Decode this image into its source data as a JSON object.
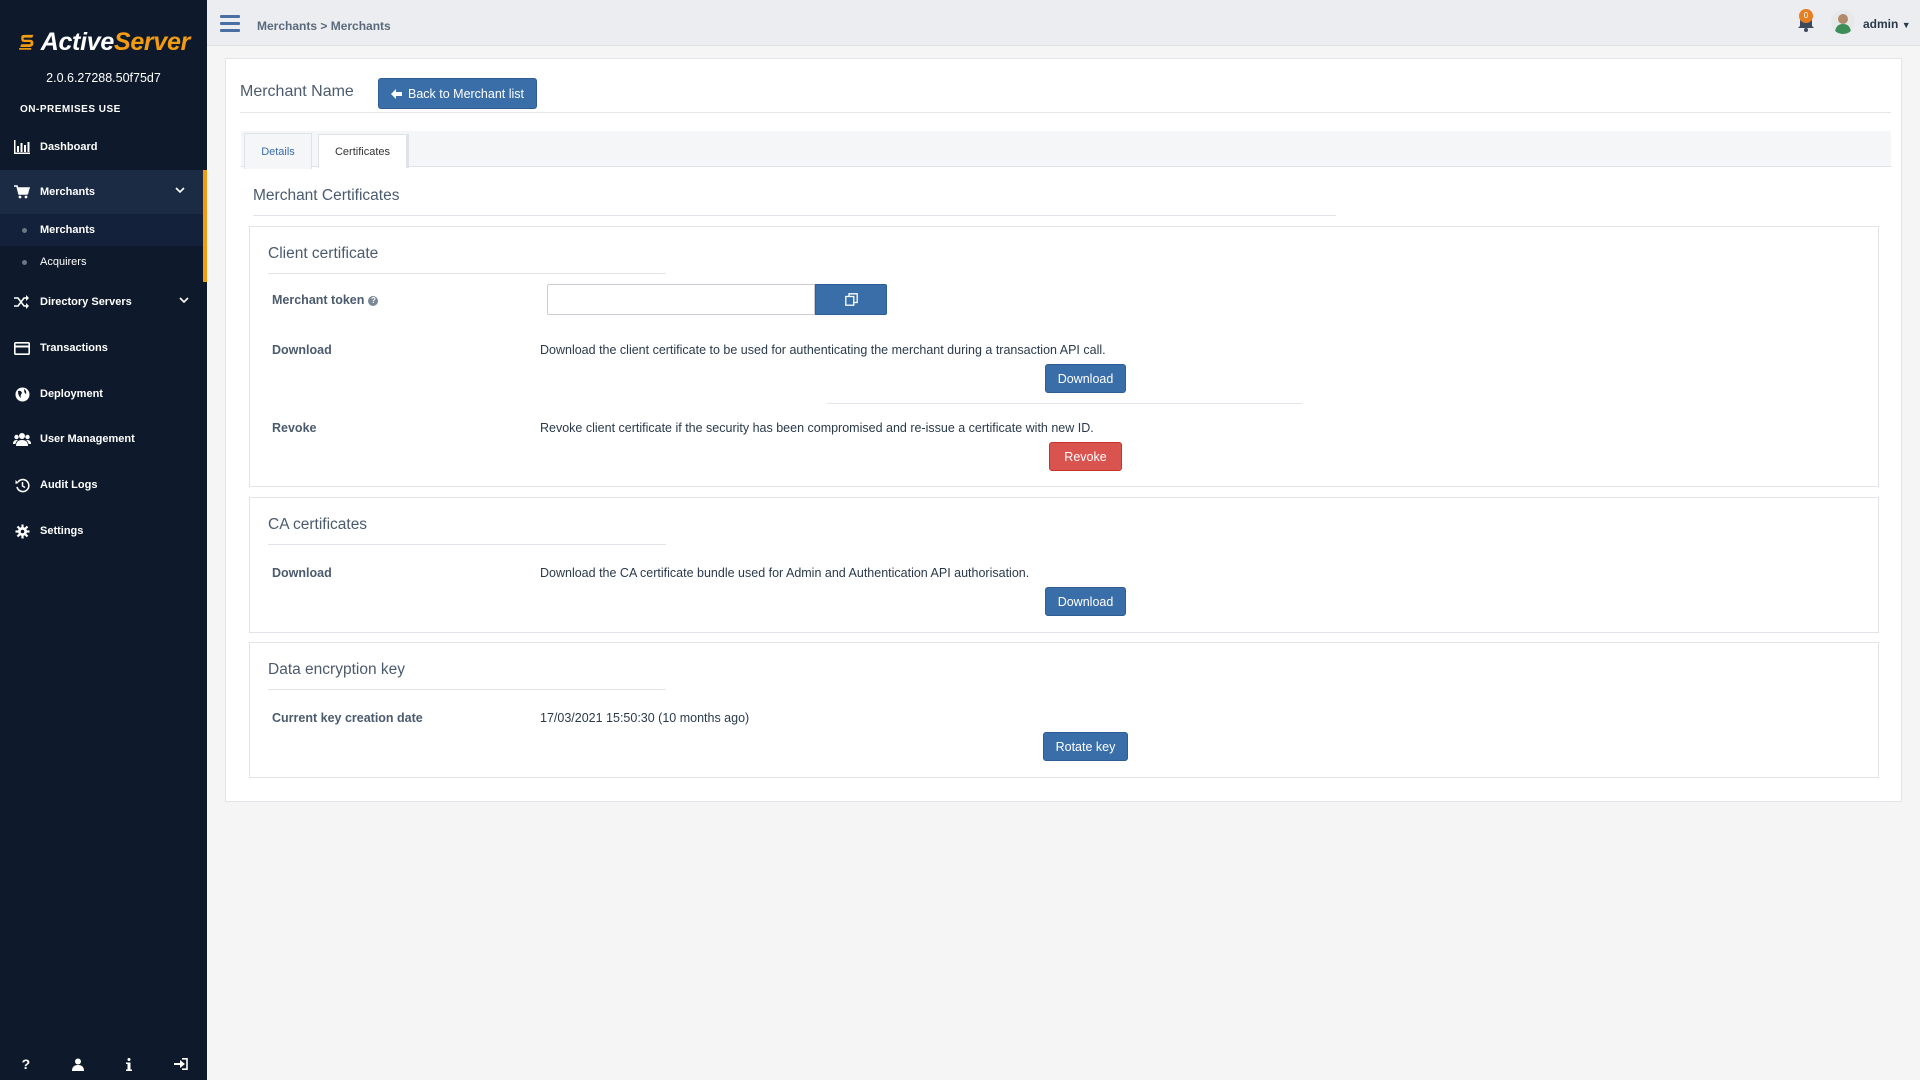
{
  "app": {
    "logo_word1": "Active",
    "logo_word2": "Server",
    "version": "2.0.6.27288.50f75d7",
    "edition": "ON-PREMISES USE"
  },
  "sidebar": {
    "items": [
      {
        "label": "Dashboard",
        "icon": "bar-chart-icon"
      },
      {
        "label": "Merchants",
        "icon": "cart-icon"
      },
      {
        "label": "Directory Servers",
        "icon": "shuffle-icon"
      },
      {
        "label": "Transactions",
        "icon": "credit-card-icon"
      },
      {
        "label": "Deployment",
        "icon": "globe-icon"
      },
      {
        "label": "User Management",
        "icon": "users-icon"
      },
      {
        "label": "Audit Logs",
        "icon": "history-icon"
      },
      {
        "label": "Settings",
        "icon": "gear-icon"
      }
    ],
    "sub_items": [
      {
        "label": "Merchants"
      },
      {
        "label": "Acquirers"
      }
    ],
    "footer_icons": [
      "help-icon",
      "user-icon",
      "info-icon",
      "sign-out-icon"
    ]
  },
  "topbar": {
    "breadcrumb": "Merchants > Merchants",
    "notification_count": "0",
    "user": "admin"
  },
  "page": {
    "merchant_name": "Merchant Name",
    "back_button": "Back to Merchant list",
    "tabs": [
      {
        "label": "Details"
      },
      {
        "label": "Certificates"
      }
    ],
    "section_title": "Merchant Certificates"
  },
  "client_certificate": {
    "title": "Client certificate",
    "token_label": "Merchant token",
    "token_value": "",
    "download_label": "Download",
    "download_desc": "Download the client certificate to be used for authenticating the merchant during a transaction API call.",
    "download_button": "Download",
    "revoke_label": "Revoke",
    "revoke_desc": "Revoke client certificate if the security has been compromised and re-issue a certificate with new ID.",
    "revoke_button": "Revoke"
  },
  "ca_certificates": {
    "title": "CA certificates",
    "download_label": "Download",
    "download_desc": "Download the CA certificate bundle used for Admin and Authentication API authorisation.",
    "download_button": "Download"
  },
  "data_encryption_key": {
    "title": "Data encryption key",
    "date_label": "Current key creation date",
    "date_value": "17/03/2021 15:50:30 (10 months ago)",
    "rotate_button": "Rotate key"
  },
  "colors": {
    "sidebar_bg": "#0e1a2b",
    "accent": "#f39c12",
    "primary": "#3a6ea8",
    "danger": "#d9534f"
  }
}
